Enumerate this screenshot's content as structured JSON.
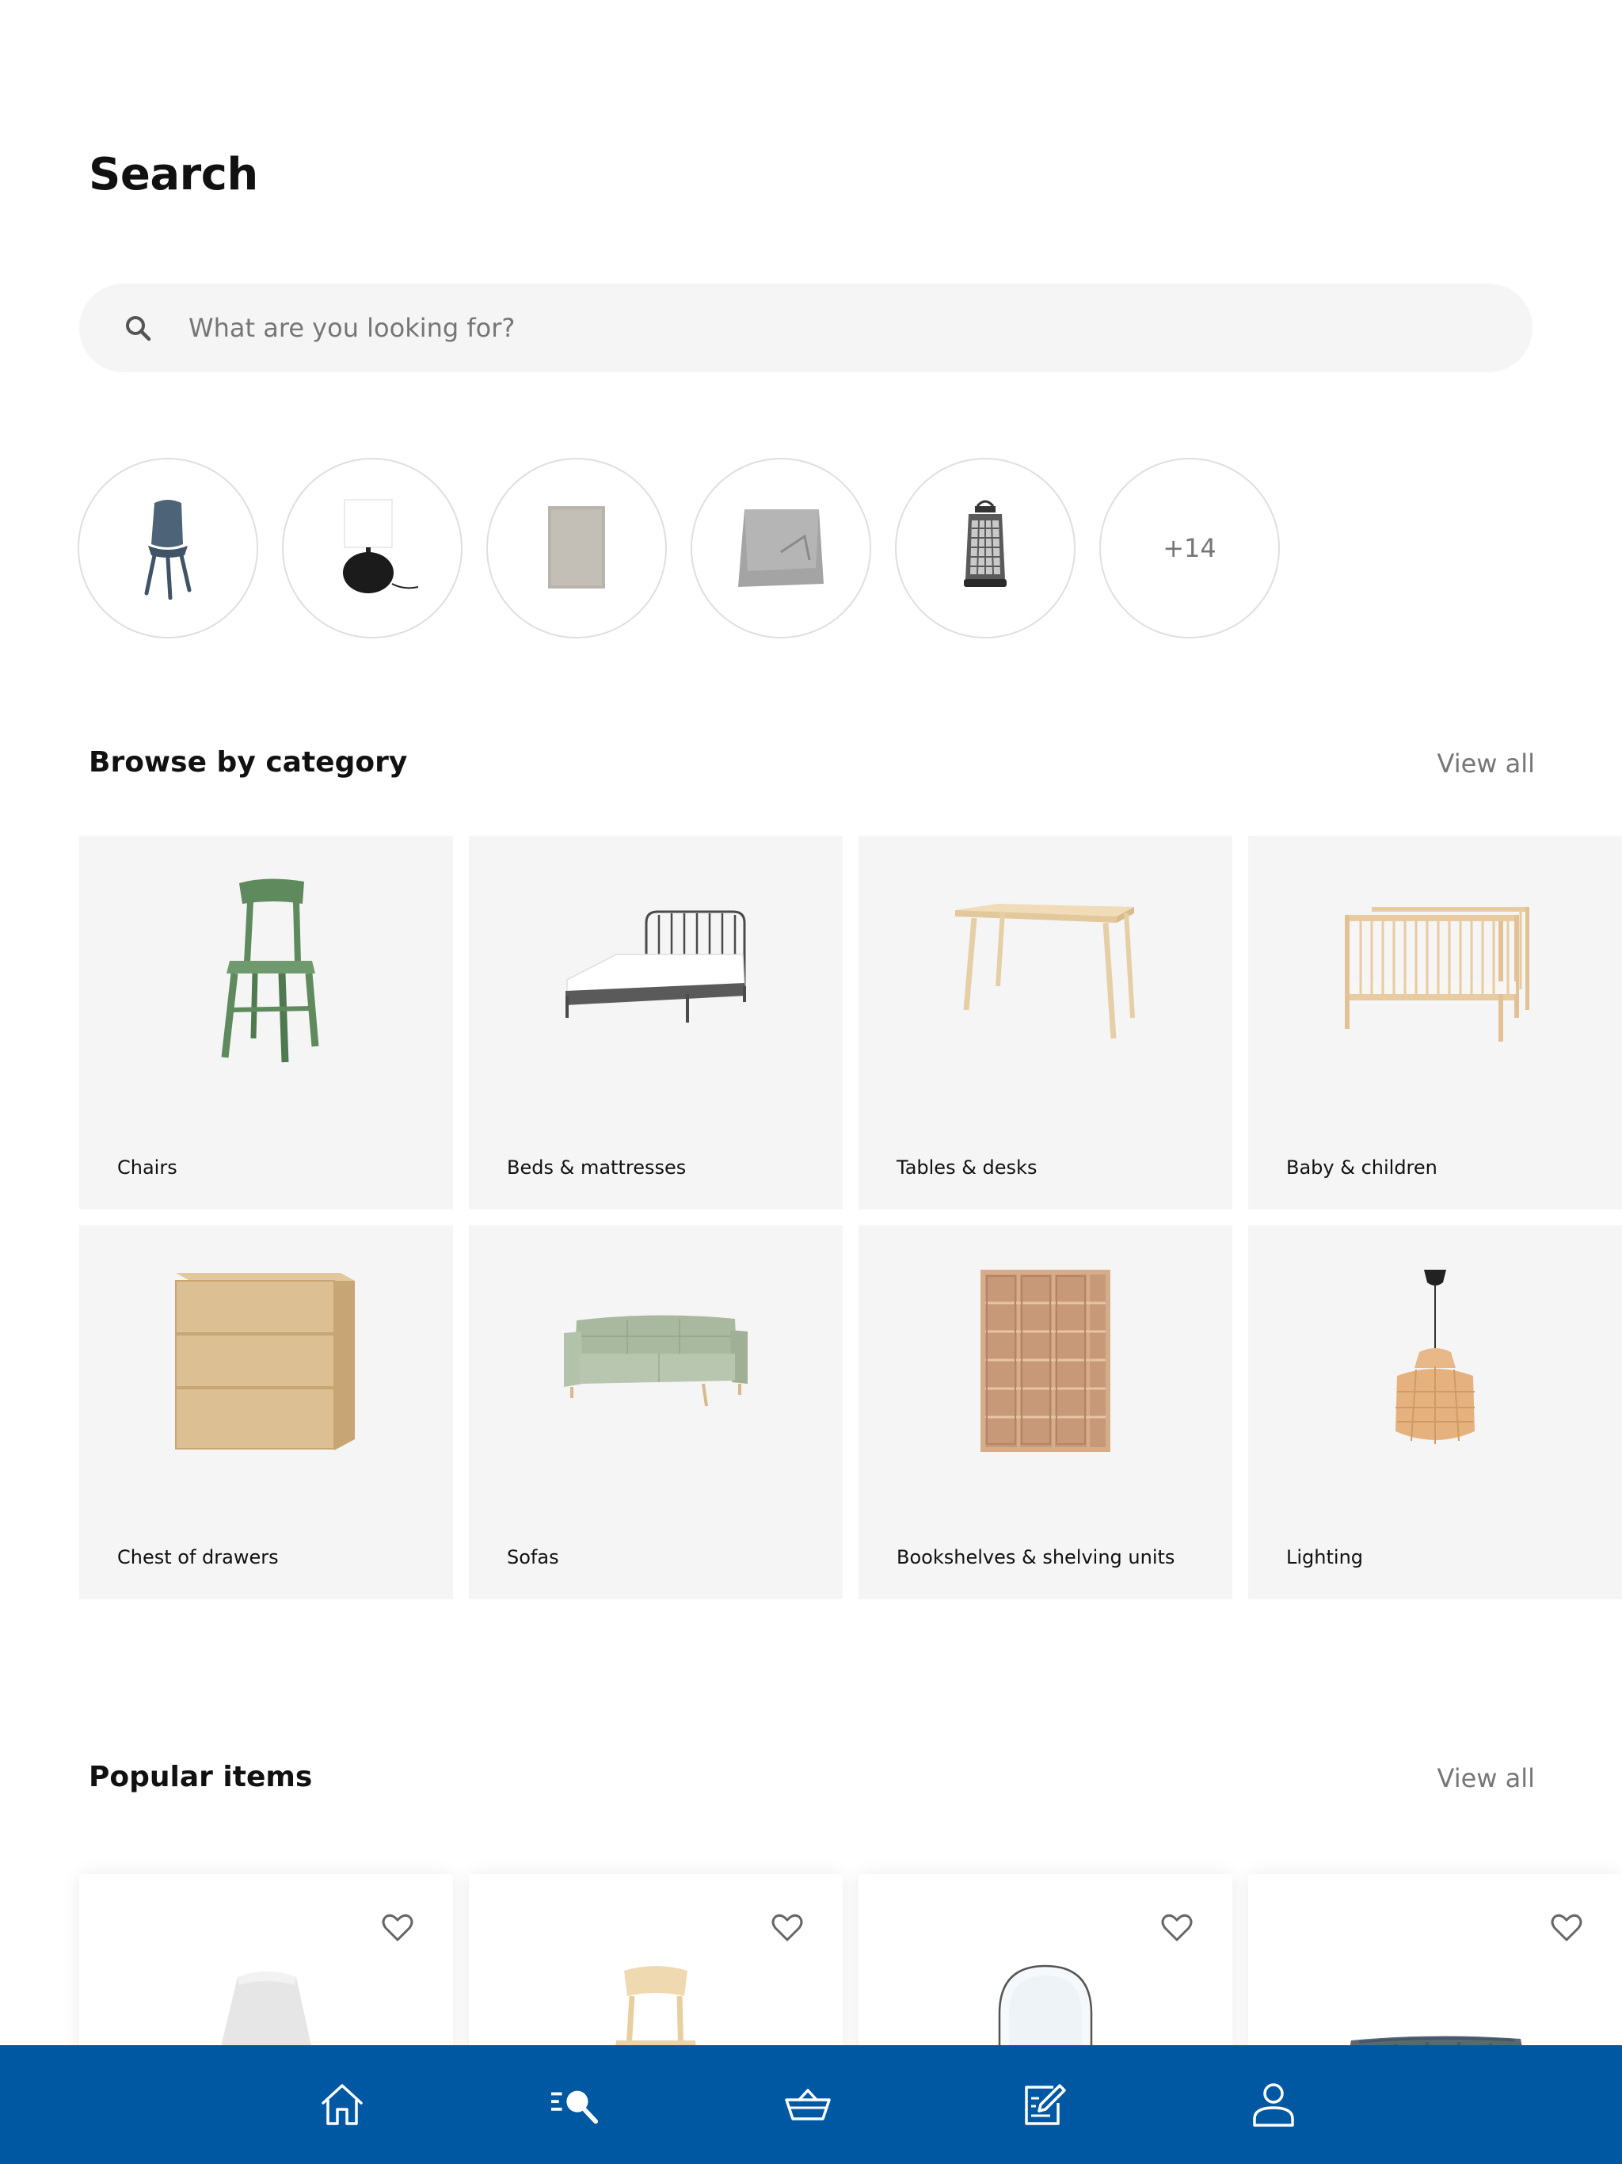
{
  "header": {
    "title": "Search"
  },
  "search": {
    "placeholder": "What are you looking for?"
  },
  "recent_searches": {
    "items": [
      {
        "icon": "chair-icon"
      },
      {
        "icon": "table-lamp-icon"
      },
      {
        "icon": "rug-icon"
      },
      {
        "icon": "throw-blanket-icon"
      },
      {
        "icon": "lantern-icon"
      }
    ],
    "more_label": "+14"
  },
  "browse": {
    "title": "Browse by category",
    "view_all": "View all",
    "categories": [
      {
        "label": "Chairs"
      },
      {
        "label": "Beds & mattresses"
      },
      {
        "label": "Tables & desks"
      },
      {
        "label": "Baby & children"
      },
      {
        "label": "Chest of drawers"
      },
      {
        "label": "Sofas"
      },
      {
        "label": "Bookshelves & shelving units"
      },
      {
        "label": "Lighting"
      }
    ]
  },
  "popular": {
    "title": "Popular items",
    "view_all": "View all",
    "items": [
      {
        "icon": "lamp-shade-icon"
      },
      {
        "icon": "wooden-chair-icon"
      },
      {
        "icon": "mirror-icon"
      },
      {
        "icon": "sofa-icon"
      }
    ]
  },
  "bottom_nav": {
    "items": [
      {
        "icon": "home-icon"
      },
      {
        "icon": "search-list-icon"
      },
      {
        "icon": "basket-icon"
      },
      {
        "icon": "shopping-list-icon"
      },
      {
        "icon": "profile-icon"
      }
    ]
  },
  "colors": {
    "nav_background": "#0058a3",
    "tile_background": "#f5f5f5",
    "muted_text": "#767676"
  }
}
